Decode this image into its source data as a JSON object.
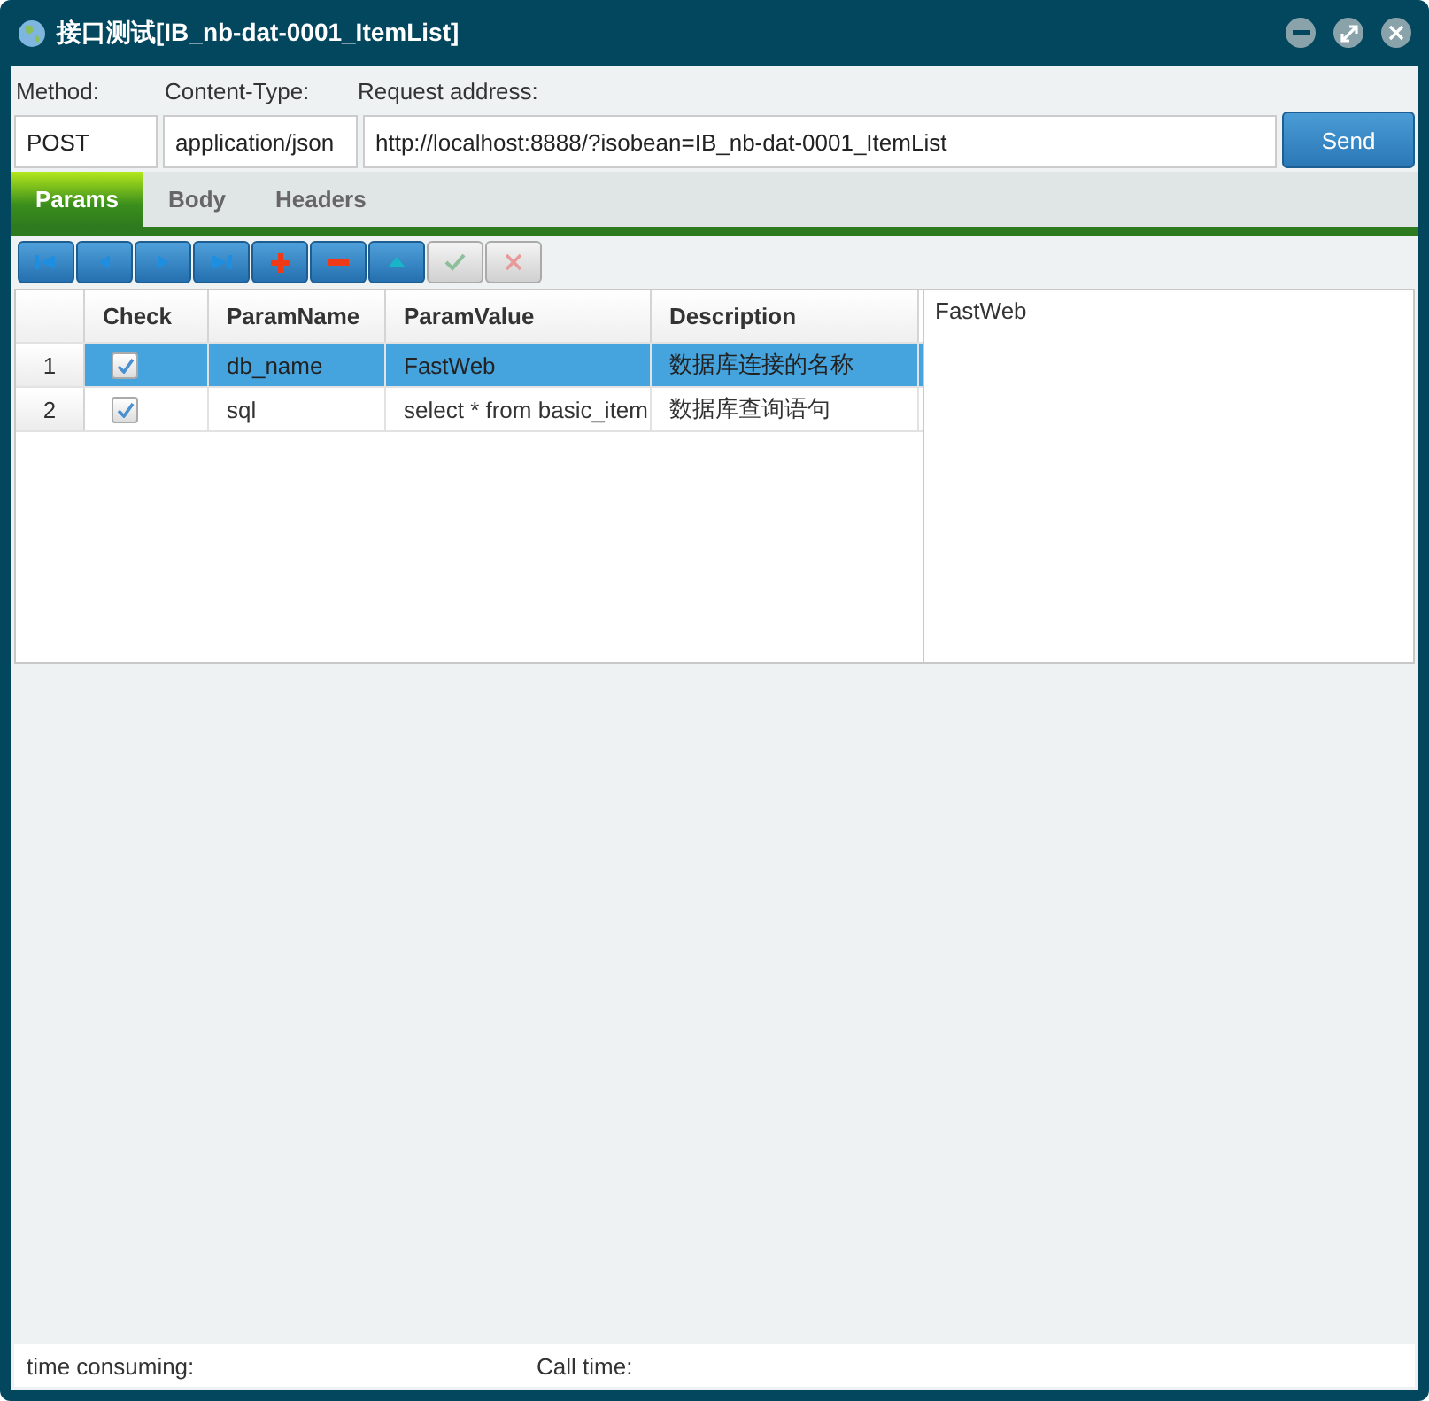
{
  "window": {
    "title": "接口测试[IB_nb-dat-0001_ItemList]"
  },
  "request": {
    "method_label": "Method:",
    "content_type_label": "Content-Type:",
    "address_label": "Request address:",
    "method": "POST",
    "content_type": "application/json",
    "address": "http://localhost:8888/?isobean=IB_nb-dat-0001_ItemList",
    "send": "Send"
  },
  "tabs": [
    {
      "label": "Params",
      "selected": true
    },
    {
      "label": "Body",
      "selected": false
    },
    {
      "label": "Headers",
      "selected": false
    }
  ],
  "toolbar": [
    {
      "kind": "first",
      "disabled": false
    },
    {
      "kind": "prev",
      "disabled": false
    },
    {
      "kind": "next",
      "disabled": false
    },
    {
      "kind": "last",
      "disabled": false
    },
    {
      "kind": "add",
      "disabled": false
    },
    {
      "kind": "remove",
      "disabled": false
    },
    {
      "kind": "edit",
      "disabled": false
    },
    {
      "kind": "post",
      "disabled": true
    },
    {
      "kind": "cancel",
      "disabled": true
    }
  ],
  "table": {
    "columns": [
      "Check",
      "ParamName",
      "ParamValue",
      "Description"
    ],
    "rows": [
      {
        "number": "1",
        "checked": true,
        "selected": true,
        "name": "db_name",
        "value": "FastWeb",
        "description": "数据库连接的名称"
      },
      {
        "number": "2",
        "checked": true,
        "selected": false,
        "name": "sql",
        "value": "select * from basic_item",
        "description": "数据库查询语句"
      }
    ]
  },
  "memo": "FastWeb",
  "status_bar": {
    "time_consuming": "time consuming:",
    "call_time": "Call time:"
  }
}
